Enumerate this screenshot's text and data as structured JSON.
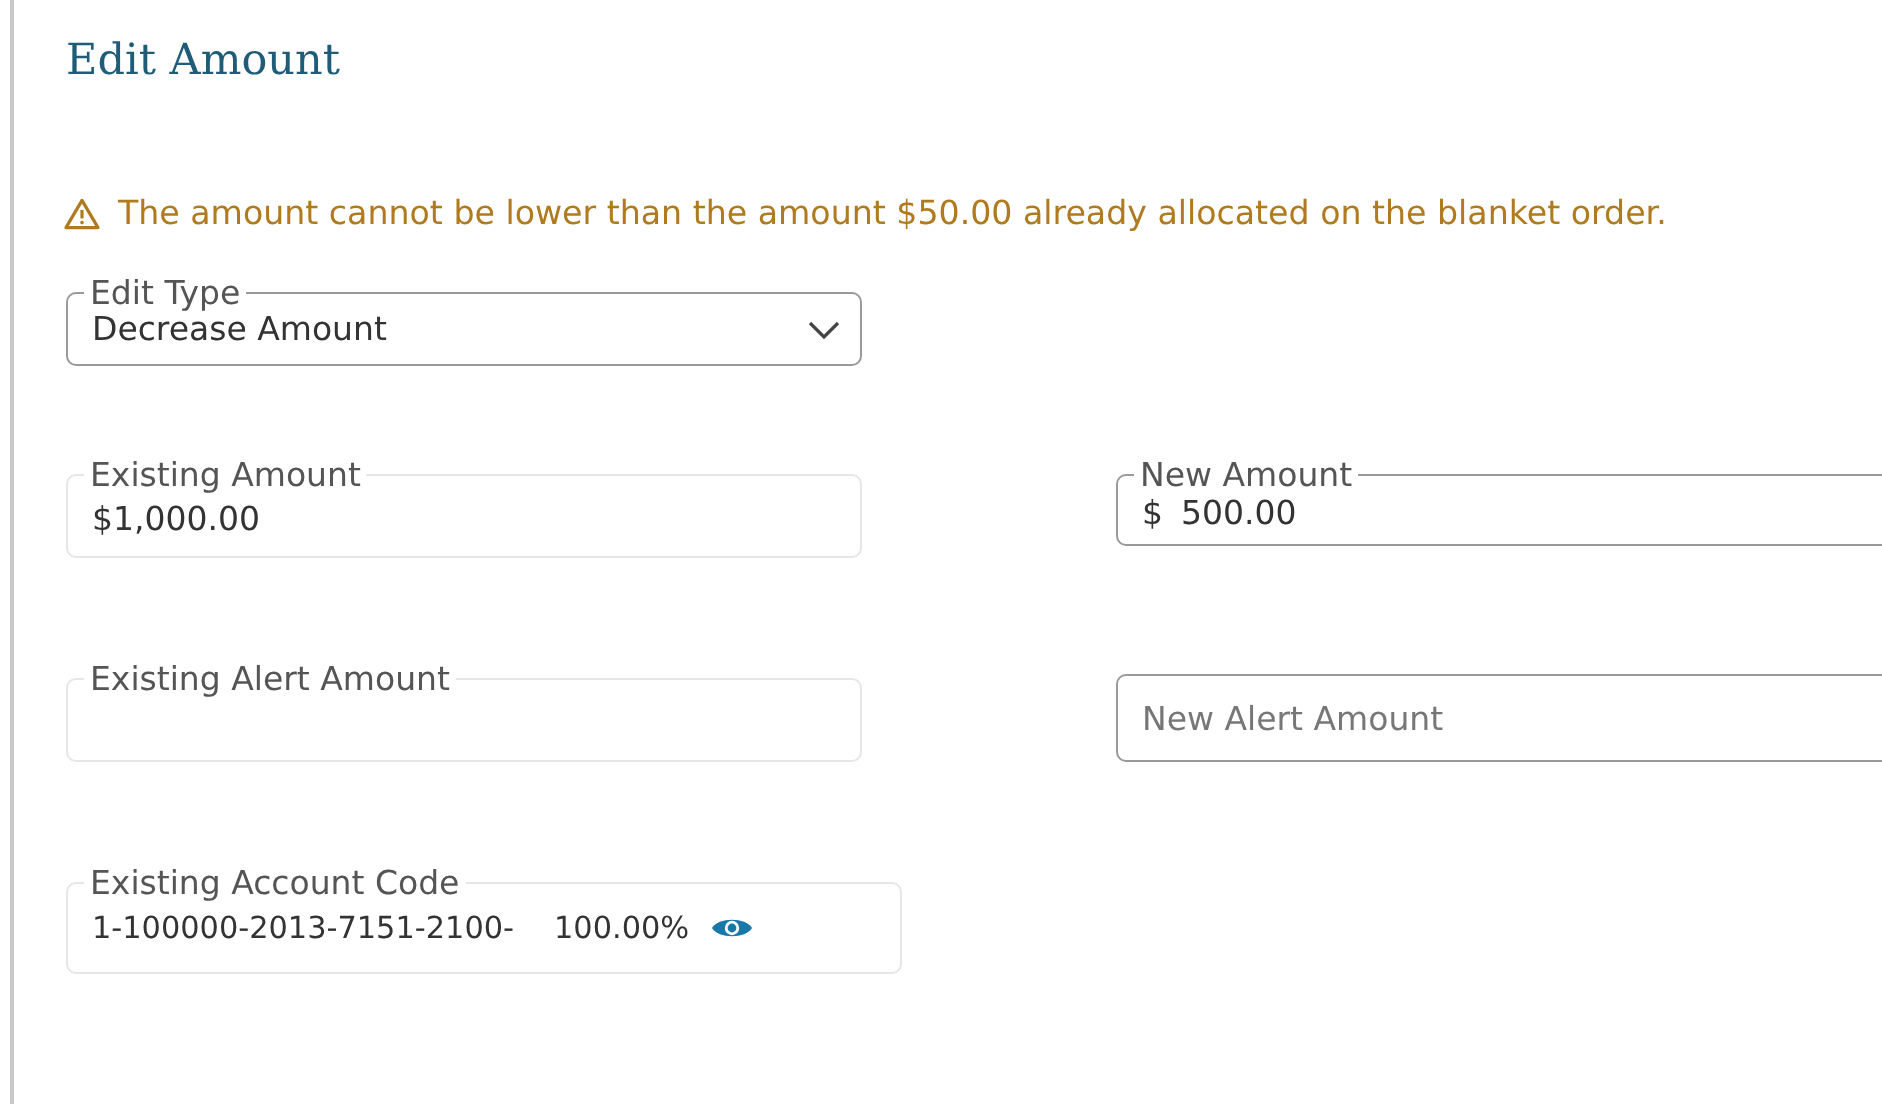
{
  "title": "Edit Amount",
  "warning": {
    "text": "The amount cannot be lower than the amount $50.00 already allocated on the blanket order."
  },
  "edit_type": {
    "label": "Edit Type",
    "value": "Decrease Amount"
  },
  "fields": [
    {
      "kind": "readonly",
      "label": "Existing Amount",
      "value": "$1,000.00"
    },
    {
      "kind": "editable",
      "label": "New Amount",
      "prefix": "$",
      "value": "500.00"
    },
    {
      "kind": "readonly",
      "label": "Existing Alert Amount"
    },
    {
      "kind": "editable",
      "placeholder": "New Alert Amount"
    }
  ],
  "account_code": {
    "label": "Existing Account Code",
    "code": "1-100000-2013-7151-2100-",
    "percent": "100.00%"
  }
}
